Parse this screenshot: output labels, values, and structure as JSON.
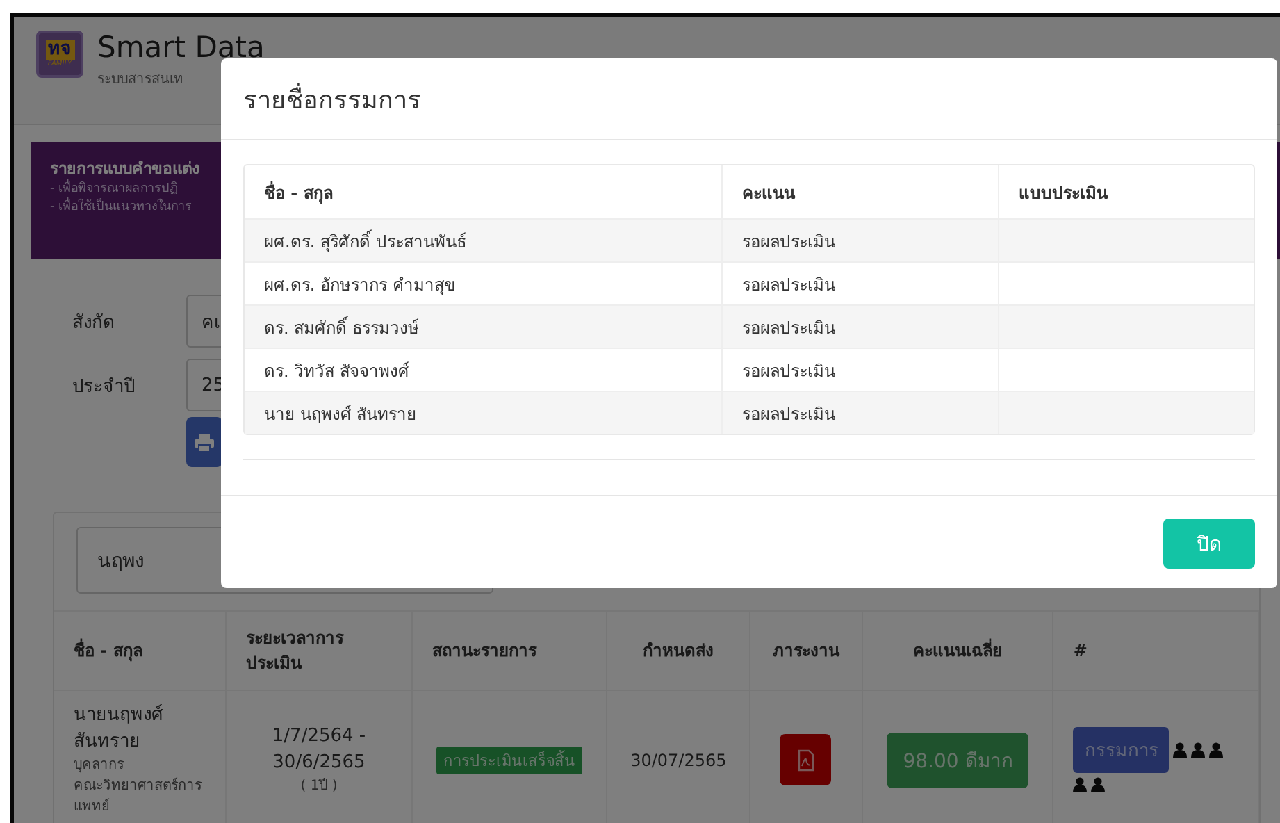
{
  "app": {
    "logo": {
      "text": "ทจ",
      "tagline": "FAMILY"
    },
    "title": "Smart Data",
    "subtitle": "ระบบสารสนเท"
  },
  "banner": {
    "title": "รายการแบบคำขอแต่ง",
    "lines": [
      "- เพื่อพิจารณาผลการปฏิ",
      "- เพื่อใช้เป็นแนวทางในการ"
    ]
  },
  "filters": [
    {
      "label": "สังกัด",
      "value": "คเ"
    },
    {
      "label": "ประจำปี",
      "value": "25"
    }
  ],
  "search": {
    "value": "นฤพง"
  },
  "table": {
    "columns": [
      "ชื่อ - สกุล",
      "ระยะเวลาการประเมิน",
      "สถานะรายการ",
      "กำหนดส่ง",
      "ภาระงาน",
      "คะแนนเฉลี่ย",
      "#"
    ],
    "rows": [
      {
        "name": "นายนฤพงศ์ สันทราย",
        "role": "บุคลากร",
        "department": "คณะวิทยาศาสตร์การแพทย์",
        "period": "1/7/2564 - 30/6/2565",
        "duration": "( 1ปี )",
        "status": "การประเมินเสร็จสิ้น",
        "due": "30/07/2565",
        "score": "98.00 ดีมาก",
        "action": "กรรมการ"
      }
    ]
  },
  "modal": {
    "title": "รายชื่อกรรมการ",
    "columns": [
      "ชื่อ - สกุล",
      "คะแนน",
      "แบบประเมิน"
    ],
    "rows": [
      {
        "name": "ผศ.ดร. สุริศักดิ์ ประสานพันธ์",
        "score": "รอผลประเมิน"
      },
      {
        "name": "ผศ.ดร. อักษรากร คำมาสุข",
        "score": "รอผลประเมิน"
      },
      {
        "name": "ดร. สมศักดิ์ ธรรมวงษ์",
        "score": "รอผลประเมิน"
      },
      {
        "name": "ดร. วิทวัส สัจจาพงศ์",
        "score": "รอผลประเมิน"
      },
      {
        "name": "นาย นฤพงศ์ สันทราย",
        "score": "รอผลประเมิน"
      }
    ],
    "close": "ปิด"
  }
}
